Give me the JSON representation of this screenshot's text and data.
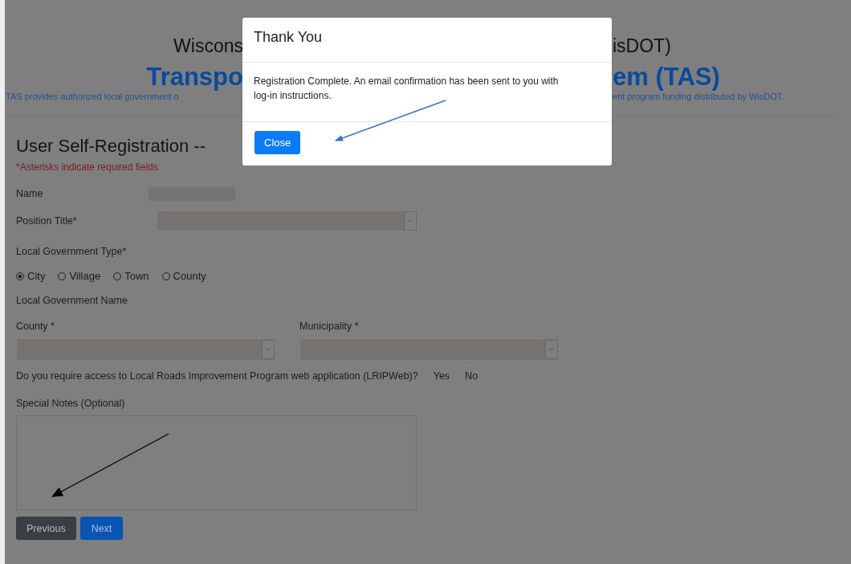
{
  "header": {
    "line_1": {
      "left": "Wiscons",
      "right": "isDOT)"
    },
    "line_2": {
      "left": "Transpo",
      "right": "em (TAS)"
    },
    "line_3": {
      "left": "TAS provides authorized local government o",
      "right": "ent program funding distributed by WisDOT."
    }
  },
  "form": {
    "heading": "User Self-Registration --",
    "required_note": "*Asterisks indicate required fields",
    "name_label": "Name",
    "position_label": "Position Title*",
    "type_label": "Local Government Type*",
    "types": [
      {
        "label": "City",
        "selected": true
      },
      {
        "label": "Village",
        "selected": false
      },
      {
        "label": "Town",
        "selected": false
      },
      {
        "label": "County",
        "selected": false
      }
    ],
    "gov_name_label": "Local Government Name",
    "county_label": "County *",
    "municipality_label": "Municipality *",
    "question": "Do you require access to Local Roads Improvement Program web application (LRIPWeb)?",
    "answers": [
      {
        "label": "Yes",
        "selected": false
      },
      {
        "label": "No",
        "selected": false
      }
    ],
    "notes_label": "Special Notes (Optional)",
    "buttons": [
      {
        "label": "Previous",
        "kind": "secondary"
      },
      {
        "label": "Next",
        "kind": "primary"
      }
    ]
  },
  "modal": {
    "title": "Thank You",
    "message": "Registration Complete. An email confirmation has been sent to you with log-in instructions.",
    "button": "Close"
  }
}
